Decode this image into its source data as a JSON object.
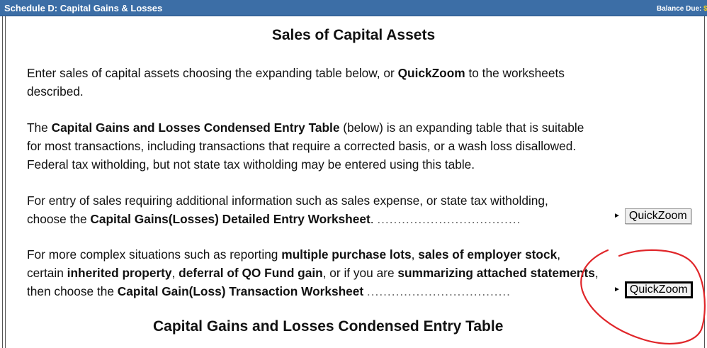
{
  "titlebar": {
    "title": "Schedule D: Capital Gains & Losses",
    "balance_label": "Balance Due: ",
    "balance_value": "$"
  },
  "main": {
    "heading": "Sales of Capital Assets",
    "intro": {
      "line1_pre": "Enter sales of capital assets choosing the expanding table below, or ",
      "line1_bold": "QuickZoom",
      "line1_post": " to the worksheets",
      "line2": "described."
    },
    "condensed": {
      "line1_pre": "The ",
      "line1_bold": "Capital Gains and Losses Condensed Entry Table",
      "line1_post": " (below) is an expanding table that is suitable",
      "line2": "for most transactions, including transactions that require a corrected basis, or a wash loss disallowed.",
      "line3": "Federal tax witholding, but not state tax witholding may be entered using this table."
    },
    "detailed": {
      "line1": "For entry of sales requiring additional information such as sales expense, or state tax witholding,",
      "line2_pre": "choose the ",
      "line2_bold": "Capital Gains(Losses) Detailed Entry Worksheet",
      "line2_post": ". ",
      "dots": "...................................",
      "quickzoom_label": "QuickZoom"
    },
    "complex": {
      "line1_pre": "For more complex situations such as reporting ",
      "line1_bold1": "multiple purchase lots",
      "line1_mid": ", ",
      "line1_bold2": "sales of employer stock",
      "line1_post": ",",
      "line2_pre": "certain ",
      "line2_bold1": "inherited property",
      "line2_mid1": ", ",
      "line2_bold2": "deferral of QO Fund gain",
      "line2_mid2": ", or if you are ",
      "line2_bold3": "summarizing attached statements",
      "line2_post": ",",
      "line3_pre": "then choose the ",
      "line3_bold": "Capital Gain(Loss) Transaction Worksheet",
      "dots": "...................................",
      "quickzoom_label": "QuickZoom"
    },
    "table_heading": "Capital Gains and Losses Condensed Entry Table"
  },
  "annotation": {
    "color": "#e0262a",
    "shape": "hand-drawn circle around QuickZoom button"
  }
}
